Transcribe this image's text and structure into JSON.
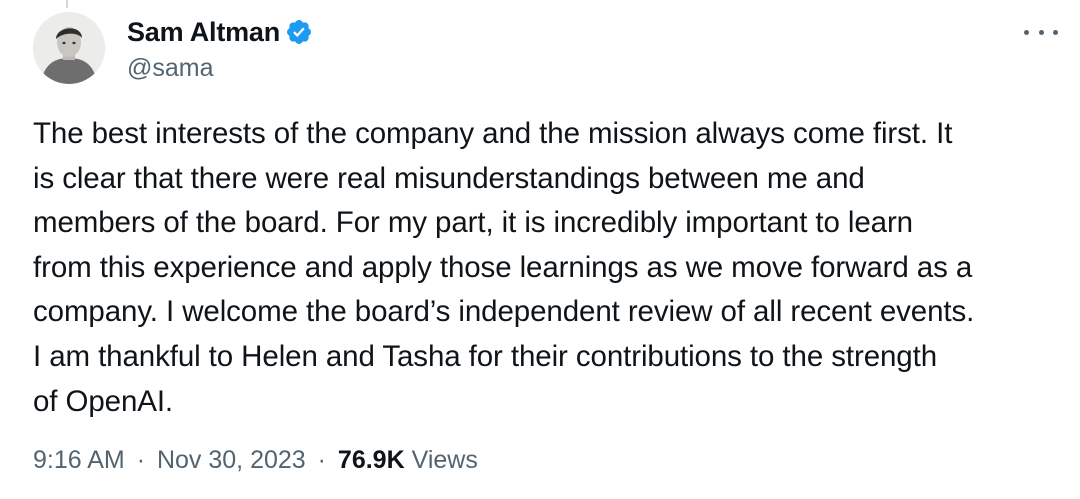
{
  "author": {
    "display_name": "Sam Altman",
    "handle": "@sama",
    "verified": true,
    "verified_icon": "verified-badge-icon",
    "verified_color": "#1d9bf0"
  },
  "menu": {
    "icon": "more-horizontal-icon"
  },
  "tweet": {
    "lines": [
      "The best interests of the company and the mission always come first. It",
      "is clear that there were real misunderstandings between me and",
      "members of the board. For my part, it is incredibly important to learn",
      "from this experience and apply those learnings as we move forward as a",
      "company. I welcome the board’s independent review of all recent events.",
      "I am thankful to Helen and Tasha for their contributions to the strength",
      "of OpenAI."
    ]
  },
  "meta": {
    "time": "9:16 AM",
    "separator": "·",
    "date": "Nov 30, 2023",
    "views_count": "76.9K",
    "views_label": "Views"
  },
  "colors": {
    "text_primary": "#0f1419",
    "text_secondary": "#536471"
  }
}
